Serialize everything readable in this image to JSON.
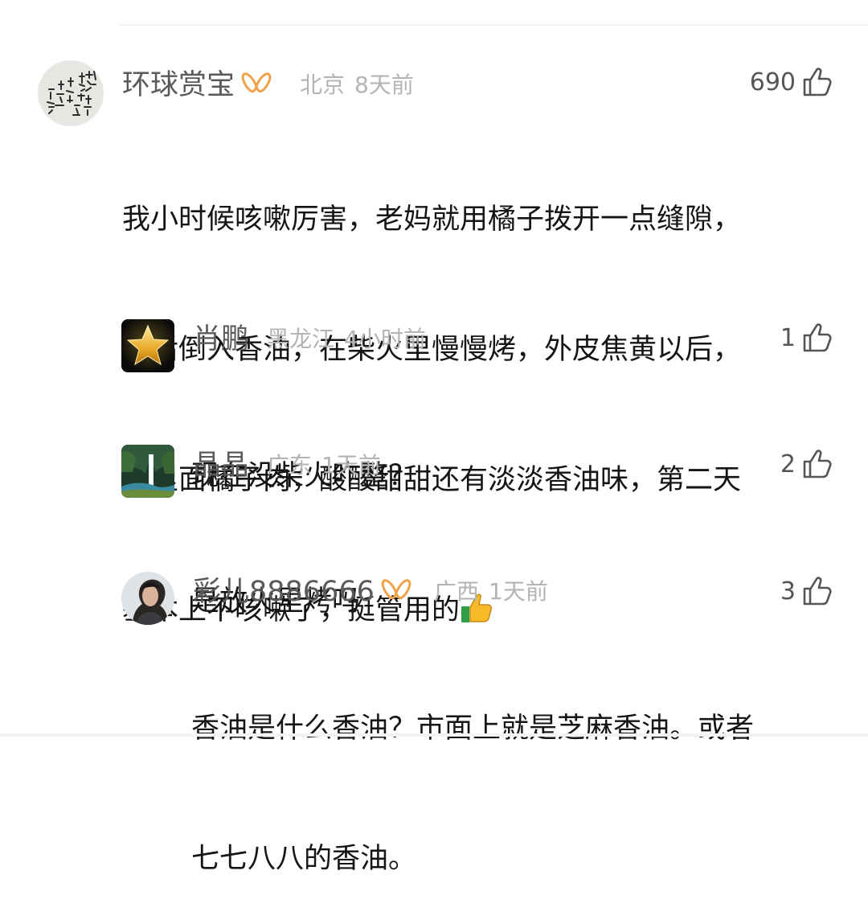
{
  "comment": {
    "author": "环球赏宝",
    "location": "北京",
    "time": "8天前",
    "likes": "690",
    "lines": [
      "我小时候咳嗽厉害，老妈就用橘子拨开一点缝隙，",
      "然后倒入香油，在柴火里慢慢烤，外皮焦黄以后，",
      "吃里面橘子肉，酸酸甜甜还有淡淡香油味，第二天",
      "基本上不咳嗽了，挺管用的"
    ]
  },
  "replies": [
    {
      "author": "肖鹏",
      "location": "黑龙江",
      "time": "4小时前",
      "likes": "1",
      "lines": [
        "现在没柴火咋整？"
      ]
    },
    {
      "author": "晶晶",
      "location": "广东",
      "time": "1天前",
      "likes": "2",
      "lines": [
        "是放火里烤吗"
      ]
    },
    {
      "author": "彩儿8886666",
      "location": "广西",
      "time": "1天前",
      "likes": "3",
      "lines": [
        "香油是什么香油？市面上就是芝麻香油。或者",
        "七七八八的香油。"
      ]
    }
  ],
  "icons": {
    "vip": "vip-badge-icon",
    "like": "thumbs-up-outline-icon",
    "emoji": "thumbs-up-emoji-icon"
  },
  "colors": {
    "vip_badge": "#f0a24a",
    "name_text": "#5a5a5a",
    "meta_text": "#b4b4b4",
    "body_text": "#151515"
  }
}
